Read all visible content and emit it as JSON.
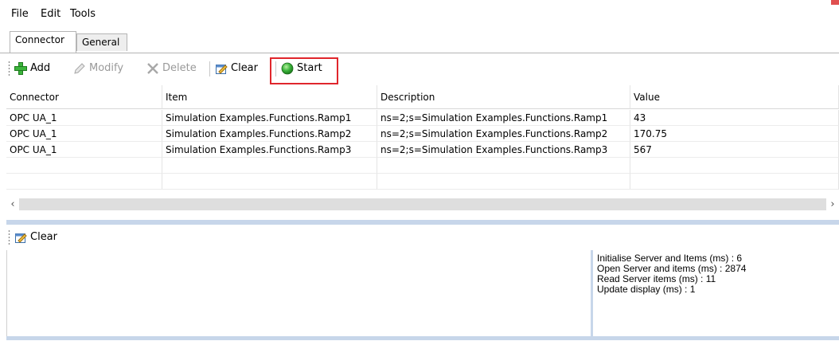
{
  "menu": {
    "items": [
      {
        "label": "File"
      },
      {
        "label": "Edit"
      },
      {
        "label": "Tools"
      }
    ]
  },
  "tabs": [
    {
      "label": "Connector",
      "active": true
    },
    {
      "label": "General",
      "active": false
    }
  ],
  "toolbar": {
    "add_label": "Add",
    "modify_label": "Modify",
    "delete_label": "Delete",
    "clear_label": "Clear",
    "start_label": "Start",
    "highlight_color": "#e0262c"
  },
  "grid": {
    "columns": [
      {
        "label": "Connector"
      },
      {
        "label": "Item"
      },
      {
        "label": "Description"
      },
      {
        "label": "Value"
      }
    ],
    "rows": [
      [
        "OPC UA_1",
        "Simulation Examples.Functions.Ramp1",
        "ns=2;s=Simulation Examples.Functions.Ramp1",
        "43"
      ],
      [
        "OPC UA_1",
        "Simulation Examples.Functions.Ramp2",
        "ns=2;s=Simulation Examples.Functions.Ramp2",
        "170.75"
      ],
      [
        "OPC UA_1",
        "Simulation Examples.Functions.Ramp3",
        "ns=2;s=Simulation Examples.Functions.Ramp3",
        "567"
      ],
      [
        "",
        "",
        "",
        ""
      ],
      [
        "",
        "",
        "",
        ""
      ]
    ]
  },
  "log": {
    "clear_label": "Clear"
  },
  "stats": [
    "Initialise Server and Items (ms) : 6",
    "Open Server and items (ms) : 2874",
    "Read Server items (ms) : 11",
    "Update display (ms) : 1"
  ],
  "colors": {
    "accent_panel": "#c7d6ea",
    "start_green": "#3cb43c"
  }
}
